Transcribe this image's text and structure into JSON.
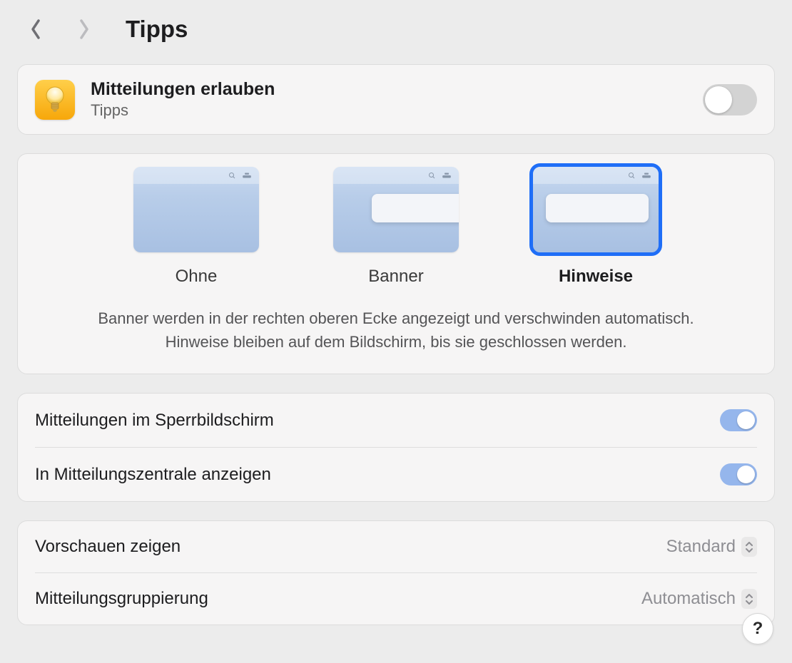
{
  "header": {
    "title": "Tipps"
  },
  "allow": {
    "title": "Mitteilungen erlauben",
    "subtitle": "Tipps",
    "enabled": false
  },
  "styles": {
    "options": [
      {
        "key": "none",
        "label": "Ohne",
        "selected": false
      },
      {
        "key": "banner",
        "label": "Banner",
        "selected": false
      },
      {
        "key": "alert",
        "label": "Hinweise",
        "selected": true
      }
    ],
    "description_line1": "Banner werden in der rechten oberen Ecke angezeigt und verschwinden automatisch.",
    "description_line2": "Hinweise bleiben auf dem Bildschirm, bis sie geschlossen werden."
  },
  "toggles": {
    "lockscreen": {
      "label": "Mitteilungen im Sperrbildschirm",
      "enabled": true
    },
    "center": {
      "label": "In Mitteilungszentrale anzeigen",
      "enabled": true
    }
  },
  "dropdowns": {
    "preview": {
      "label": "Vorschauen zeigen",
      "value": "Standard"
    },
    "grouping": {
      "label": "Mitteilungsgruppierung",
      "value": "Automatisch"
    }
  },
  "help": {
    "label": "?"
  }
}
